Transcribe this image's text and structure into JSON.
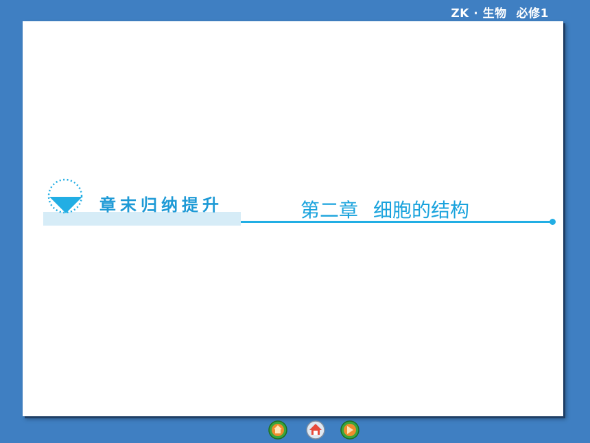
{
  "header": {
    "subject_prefix": "ZK · 生物",
    "subject_suffix": "必修1"
  },
  "slide": {
    "section_label": "章末归纳提升",
    "chapter_number": "第二章",
    "chapter_name": "细胞的结构"
  },
  "nav": {
    "buttons": [
      "home-icon",
      "house-icon",
      "next-icon"
    ]
  },
  "colors": {
    "background": "#3f7fc2",
    "accent": "#22aee4",
    "band": "#d6ecf7",
    "slide": "#ffffff"
  }
}
